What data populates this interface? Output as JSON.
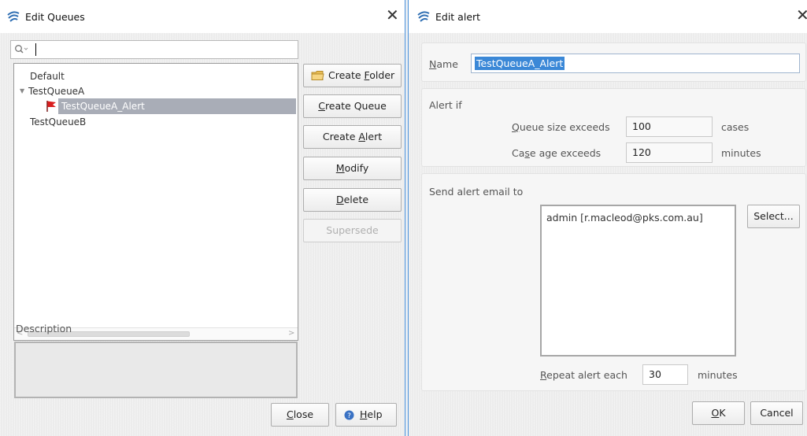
{
  "edit_queues": {
    "title": "Edit Queues",
    "close_glyph": "✕",
    "search": {
      "value": "",
      "icon": "search-icon"
    },
    "tree": [
      {
        "label": "Default",
        "level": 0
      },
      {
        "label": "TestQueueA",
        "level": 0,
        "expanded": true,
        "expander": "▼"
      },
      {
        "label": "TestQueueA_Alert",
        "level": 1,
        "selected": true,
        "icon": "flag-icon"
      },
      {
        "label": "TestQueueB",
        "level": 0
      }
    ],
    "buttons": {
      "create_folder": {
        "pre": "Create ",
        "key": "F",
        "post": "older",
        "icon": "folder-icon"
      },
      "create_queue": {
        "pre": "",
        "key": "C",
        "post": "reate Queue"
      },
      "create_alert": {
        "pre": "Create ",
        "key": "A",
        "post": "lert"
      },
      "modify": {
        "pre": "",
        "key": "M",
        "post": "odify"
      },
      "delete": {
        "pre": "",
        "key": "D",
        "post": "elete"
      },
      "supersede": {
        "label": "Supersede",
        "disabled": true
      }
    },
    "scroll_left": "<",
    "scroll_right": ">",
    "description_label": "Description",
    "description_value": "",
    "close_button": {
      "key": "C",
      "post": "lose"
    },
    "help_button": {
      "key": "H",
      "post": "elp",
      "icon": "help-icon"
    }
  },
  "edit_alert": {
    "title": "Edit alert",
    "close_glyph": "✕",
    "name": {
      "key": "N",
      "post": "ame",
      "value": "TestQueueA_Alert"
    },
    "alert_if": {
      "heading": "Alert if",
      "queue_size": {
        "key": "Q",
        "post": "ueue size exceeds",
        "value": "100",
        "unit": "cases"
      },
      "case_age": {
        "pre": "Ca",
        "key": "s",
        "post": "e age exceeds",
        "value": "120",
        "unit": "minutes"
      }
    },
    "send_email": {
      "heading": "Send alert email to",
      "recipients": [
        "admin [r.macleod@pks.com.au]"
      ],
      "select_button": "Select...",
      "repeat": {
        "key": "R",
        "post": "epeat alert each",
        "value": "30",
        "unit": "minutes"
      }
    },
    "ok_button": {
      "key": "O",
      "post": "K"
    },
    "cancel_button": "Cancel"
  },
  "colors": {
    "selection": "#3b88d7",
    "tree_selection": "#a9adb7",
    "window_border": "#4a90d9"
  }
}
